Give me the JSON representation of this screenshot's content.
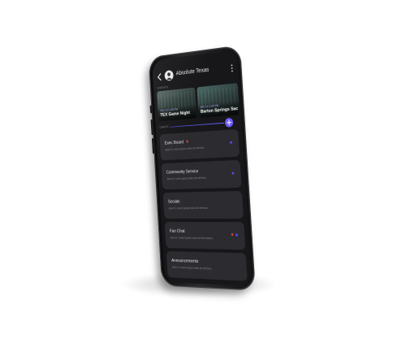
{
  "app": {
    "title": "Absolute Texas"
  },
  "icons": {
    "back": "chevron-left-icon",
    "more": "vertical-ellipsis-icon",
    "add": "plus-icon",
    "avatar": "profile-avatar"
  },
  "events": {
    "label": "EVENTS",
    "items": [
      {
        "date": "THU, 12 | 6:00 PM",
        "name": "TEX Game Night"
      },
      {
        "date": "SAT, 14 | 1:00 PM",
        "name": "Barton Springs Sac"
      }
    ]
  },
  "chats": {
    "label": "CHATS",
    "items": [
      {
        "name": "Exec Board",
        "preview": "Jane D: Lorem ipsum dolor sit met bus...",
        "unread": true
      },
      {
        "name": "Community Service",
        "preview": "Jane D: Lorem ipsum dolor sit met bus...",
        "unread": true
      },
      {
        "name": "Socials",
        "preview": "Jane D: Lorem ipsum dolor sit met bus...",
        "unread": false
      },
      {
        "name": "Fan Chat",
        "preview": "Jane D: Lorem ipsum dolor sit met busine...",
        "unread": true
      },
      {
        "name": "Announcements",
        "preview": "Jane D: Lorem ipsum dolor sit met bus...",
        "unread": false
      }
    ]
  },
  "colors": {
    "accent": "#6e5cff",
    "unread": "#5b4cf0",
    "pin": "#e0463f",
    "screen": "#17171a",
    "card": "#2b2b30"
  }
}
